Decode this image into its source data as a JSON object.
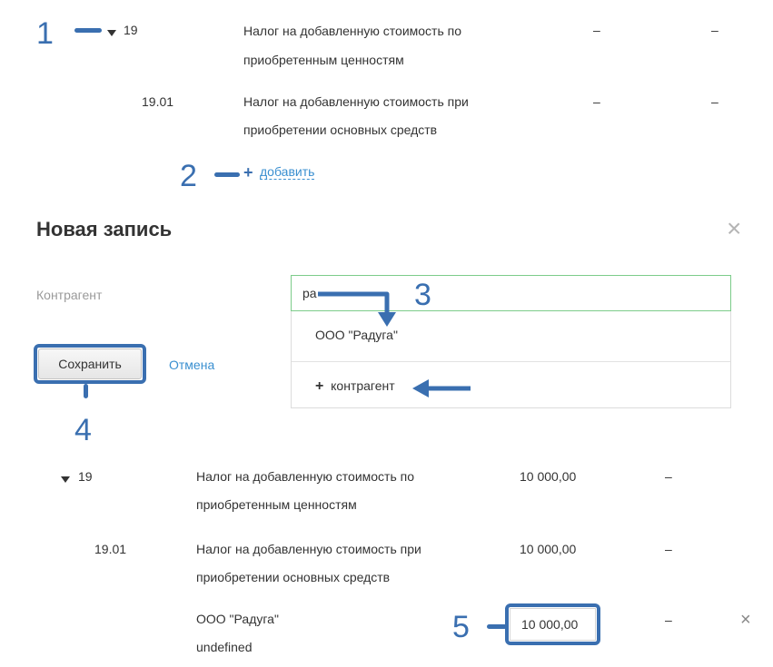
{
  "callouts": [
    "1",
    "2",
    "3",
    "4",
    "5"
  ],
  "top_table": {
    "rows": [
      {
        "code": "19",
        "line1": "Налог на добавленную стоимость по",
        "line2": "приобретенным ценностям",
        "col1": "–",
        "col2": "–"
      },
      {
        "code": "19.01",
        "line1": "Налог на добавленную стоимость при",
        "line2": "приобретении основных средств",
        "col1": "–",
        "col2": "–"
      }
    ],
    "add_label": "добавить"
  },
  "dialog": {
    "title": "Новая запись",
    "field_label": "Контрагент",
    "input_value": "ра",
    "suggestion": "ООО \"Радуга\"",
    "add_counterparty": "контрагент",
    "save_label": "Сохранить",
    "cancel_label": "Отмена"
  },
  "bottom_table": {
    "rows": [
      {
        "code": "19",
        "line1": "Налог на добавленную стоимость по",
        "line2": "приобретенным ценностям",
        "amount": "10 000,00",
        "col2": "–"
      },
      {
        "code": "19.01",
        "line1": "Налог на добавленную стоимость при",
        "line2": "приобретении основных средств",
        "amount": "10 000,00",
        "col2": "–"
      }
    ],
    "entry": {
      "name": "ООО \"Радуга\"",
      "sub": "undefined",
      "amount": "10 000,00",
      "col2": "–"
    }
  },
  "colors": {
    "callout": "#3a6fb0",
    "link": "#3a8fd0",
    "input_focus": "#7ccc8a"
  }
}
